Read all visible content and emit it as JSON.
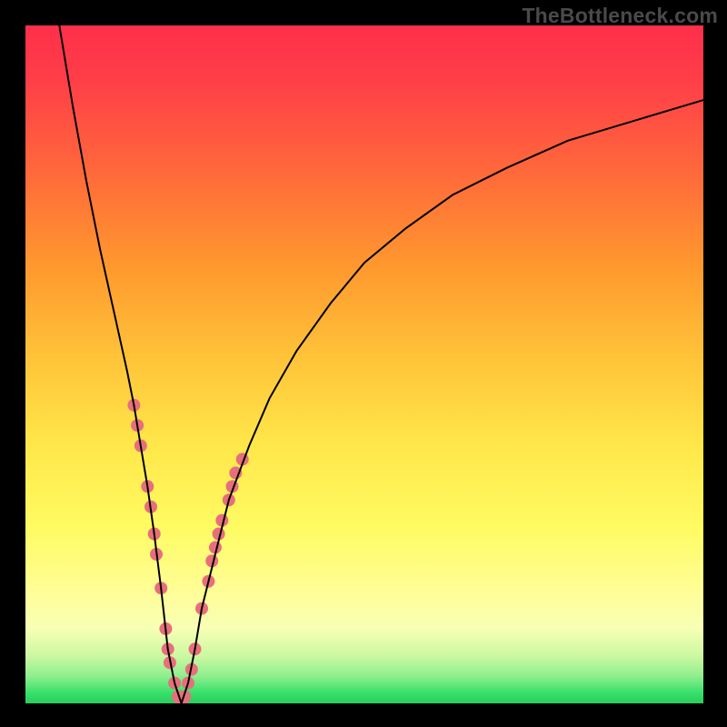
{
  "watermark": "TheBottleneck.com",
  "chart_data": {
    "type": "line",
    "title": "",
    "xlabel": "",
    "ylabel": "",
    "xlim": [
      0,
      100
    ],
    "ylim": [
      0,
      100
    ],
    "grid": false,
    "legend": false,
    "background": {
      "type": "vertical-gradient",
      "stops": [
        {
          "pos": 0,
          "color": "#ff2f4a"
        },
        {
          "pos": 22,
          "color": "#ff6a3a"
        },
        {
          "pos": 50,
          "color": "#ffc63a"
        },
        {
          "pos": 74,
          "color": "#fffb62"
        },
        {
          "pos": 96,
          "color": "#8eef8d"
        },
        {
          "pos": 100,
          "color": "#29cd5c"
        }
      ]
    },
    "series": [
      {
        "name": "bottleneck-curve",
        "color": "#000000",
        "stroke_width": 2,
        "x": [
          5,
          7,
          9,
          11,
          13,
          15,
          16,
          17,
          18,
          19,
          20,
          21,
          22,
          23,
          24,
          25,
          26,
          28,
          30,
          33,
          36,
          40,
          45,
          50,
          56,
          63,
          71,
          80,
          90,
          100
        ],
        "values": [
          100,
          88,
          77,
          67,
          58,
          49,
          44,
          38,
          32,
          25,
          17,
          8,
          3,
          0,
          3,
          8,
          14,
          22,
          30,
          38,
          45,
          52,
          59,
          65,
          70,
          75,
          79,
          83,
          86,
          89
        ]
      }
    ],
    "markers": {
      "name": "data-points",
      "color": "#e76f7b",
      "radius": 7,
      "points": [
        {
          "x": 16.0,
          "y": 44
        },
        {
          "x": 16.5,
          "y": 41
        },
        {
          "x": 17.0,
          "y": 38
        },
        {
          "x": 18.0,
          "y": 32
        },
        {
          "x": 18.5,
          "y": 29
        },
        {
          "x": 19.0,
          "y": 25
        },
        {
          "x": 19.3,
          "y": 22
        },
        {
          "x": 20.0,
          "y": 17
        },
        {
          "x": 20.7,
          "y": 11
        },
        {
          "x": 21.0,
          "y": 8
        },
        {
          "x": 21.3,
          "y": 6
        },
        {
          "x": 22.0,
          "y": 3
        },
        {
          "x": 22.5,
          "y": 1
        },
        {
          "x": 23.0,
          "y": 0
        },
        {
          "x": 23.5,
          "y": 1
        },
        {
          "x": 24.0,
          "y": 3
        },
        {
          "x": 24.5,
          "y": 5
        },
        {
          "x": 25.0,
          "y": 8
        },
        {
          "x": 26.0,
          "y": 14
        },
        {
          "x": 27.0,
          "y": 18
        },
        {
          "x": 27.5,
          "y": 21
        },
        {
          "x": 28.0,
          "y": 23
        },
        {
          "x": 28.5,
          "y": 25
        },
        {
          "x": 29.0,
          "y": 27
        },
        {
          "x": 30.0,
          "y": 30
        },
        {
          "x": 30.5,
          "y": 32
        },
        {
          "x": 31.0,
          "y": 34
        },
        {
          "x": 32.0,
          "y": 36
        }
      ]
    }
  }
}
